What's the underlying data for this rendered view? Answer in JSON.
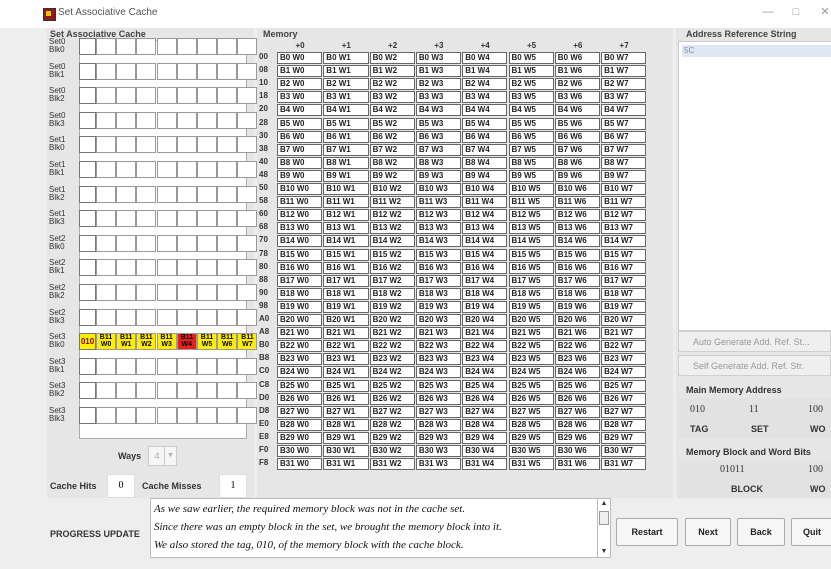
{
  "window": {
    "title": "Set Associative Cache",
    "minimize": "—",
    "maximize": "□",
    "close": "✕"
  },
  "cache": {
    "title": "Set Associative Cache",
    "rows": [
      {
        "set": "Set0",
        "blk": "Blk0",
        "tag": "",
        "cells": [
          "",
          "",
          "",
          "",
          "",
          "",
          "",
          ""
        ],
        "filled": false
      },
      {
        "set": "Set0",
        "blk": "Blk1",
        "tag": "",
        "cells": [
          "",
          "",
          "",
          "",
          "",
          "",
          "",
          ""
        ],
        "filled": false
      },
      {
        "set": "Set0",
        "blk": "Blk2",
        "tag": "",
        "cells": [
          "",
          "",
          "",
          "",
          "",
          "",
          "",
          ""
        ],
        "filled": false
      },
      {
        "set": "Set0",
        "blk": "Blk3",
        "tag": "",
        "cells": [
          "",
          "",
          "",
          "",
          "",
          "",
          "",
          ""
        ],
        "filled": false
      },
      {
        "set": "Set1",
        "blk": "Blk0",
        "tag": "",
        "cells": [
          "",
          "",
          "",
          "",
          "",
          "",
          "",
          ""
        ],
        "filled": false
      },
      {
        "set": "Set1",
        "blk": "Blk1",
        "tag": "",
        "cells": [
          "",
          "",
          "",
          "",
          "",
          "",
          "",
          ""
        ],
        "filled": false
      },
      {
        "set": "Set1",
        "blk": "Blk2",
        "tag": "",
        "cells": [
          "",
          "",
          "",
          "",
          "",
          "",
          "",
          ""
        ],
        "filled": false
      },
      {
        "set": "Set1",
        "blk": "Blk3",
        "tag": "",
        "cells": [
          "",
          "",
          "",
          "",
          "",
          "",
          "",
          ""
        ],
        "filled": false
      },
      {
        "set": "Set2",
        "blk": "Blk0",
        "tag": "",
        "cells": [
          "",
          "",
          "",
          "",
          "",
          "",
          "",
          ""
        ],
        "filled": false
      },
      {
        "set": "Set2",
        "blk": "Blk1",
        "tag": "",
        "cells": [
          "",
          "",
          "",
          "",
          "",
          "",
          "",
          ""
        ],
        "filled": false
      },
      {
        "set": "Set2",
        "blk": "Blk2",
        "tag": "",
        "cells": [
          "",
          "",
          "",
          "",
          "",
          "",
          "",
          ""
        ],
        "filled": false
      },
      {
        "set": "Set2",
        "blk": "Blk3",
        "tag": "",
        "cells": [
          "",
          "",
          "",
          "",
          "",
          "",
          "",
          ""
        ],
        "filled": false
      },
      {
        "set": "Set3",
        "blk": "Blk0",
        "tag": "010",
        "cells": [
          "B11 W0",
          "B11 W1",
          "B11 W2",
          "B11 W3",
          "B11 W4",
          "B11 W5",
          "B11 W6",
          "B11 W7"
        ],
        "filled": true
      },
      {
        "set": "Set3",
        "blk": "Blk1",
        "tag": "",
        "cells": [
          "",
          "",
          "",
          "",
          "",
          "",
          "",
          ""
        ],
        "filled": false
      },
      {
        "set": "Set3",
        "blk": "Blk2",
        "tag": "",
        "cells": [
          "",
          "",
          "",
          "",
          "",
          "",
          "",
          ""
        ],
        "filled": false
      },
      {
        "set": "Set3",
        "blk": "Blk3",
        "tag": "",
        "cells": [
          "",
          "",
          "",
          "",
          "",
          "",
          "",
          ""
        ],
        "filled": false
      }
    ],
    "ways_label": "Ways",
    "ways_value": "4",
    "hits_label": "Cache Hits",
    "hits_value": "0",
    "misses_label": "Cache Misses",
    "misses_value": "1",
    "colors": {
      "filled": "#ffee00",
      "current_word": "#e8201a",
      "tag_text": "#7a0000"
    }
  },
  "memory": {
    "title": "Memory",
    "offsets": [
      "+0",
      "+1",
      "+2",
      "+3",
      "+4",
      "+5",
      "+6",
      "+7"
    ],
    "addresses": [
      "00",
      "08",
      "10",
      "18",
      "20",
      "28",
      "30",
      "38",
      "40",
      "48",
      "50",
      "58",
      "60",
      "68",
      "70",
      "78",
      "80",
      "88",
      "90",
      "98",
      "A0",
      "A8",
      "B0",
      "B8",
      "C0",
      "C8",
      "D0",
      "D8",
      "E0",
      "E8",
      "F0",
      "F8"
    ],
    "rows": [
      [
        "B0 W0",
        "B0 W1",
        "B0 W2",
        "B0 W3",
        "B0 W4",
        "B0 W5",
        "B0 W6",
        "B0 W7"
      ],
      [
        "B1 W0",
        "B1 W1",
        "B1 W2",
        "B1 W3",
        "B1 W4",
        "B1 W5",
        "B1 W6",
        "B1 W7"
      ],
      [
        "B2 W0",
        "B2 W1",
        "B2 W2",
        "B2 W3",
        "B2 W4",
        "B2 W5",
        "B2 W6",
        "B2 W7"
      ],
      [
        "B3 W0",
        "B3 W1",
        "B3 W2",
        "B3 W3",
        "B3 W4",
        "B3 W5",
        "B3 W6",
        "B3 W7"
      ],
      [
        "B4 W0",
        "B4 W1",
        "B4 W2",
        "B4 W3",
        "B4 W4",
        "B4 W5",
        "B4 W6",
        "B4 W7"
      ],
      [
        "B5 W0",
        "B5 W1",
        "B5 W2",
        "B5 W3",
        "B5 W4",
        "B5 W5",
        "B5 W6",
        "B5 W7"
      ],
      [
        "B6 W0",
        "B6 W1",
        "B6 W2",
        "B6 W3",
        "B6 W4",
        "B6 W5",
        "B6 W6",
        "B6 W7"
      ],
      [
        "B7 W0",
        "B7 W1",
        "B7 W2",
        "B7 W3",
        "B7 W4",
        "B7 W5",
        "B7 W6",
        "B7 W7"
      ],
      [
        "B8 W0",
        "B8 W1",
        "B8 W2",
        "B8 W3",
        "B8 W4",
        "B8 W5",
        "B8 W6",
        "B8 W7"
      ],
      [
        "B9 W0",
        "B9 W1",
        "B9 W2",
        "B9 W3",
        "B9 W4",
        "B9 W5",
        "B9 W6",
        "B9 W7"
      ],
      [
        "B10 W0",
        "B10 W1",
        "B10 W2",
        "B10 W3",
        "B10 W4",
        "B10 W5",
        "B10 W6",
        "B10 W7"
      ],
      [
        "B11 W0",
        "B11 W1",
        "B11 W2",
        "B11 W3",
        "B11 W4",
        "B11 W5",
        "B11 W6",
        "B11 W7"
      ],
      [
        "B12 W0",
        "B12 W1",
        "B12 W2",
        "B12 W3",
        "B12 W4",
        "B12 W5",
        "B12 W6",
        "B12 W7"
      ],
      [
        "B13 W0",
        "B13 W1",
        "B13 W2",
        "B13 W3",
        "B13 W4",
        "B13 W5",
        "B13 W6",
        "B13 W7"
      ],
      [
        "B14 W0",
        "B14 W1",
        "B14 W2",
        "B14 W3",
        "B14 W4",
        "B14 W5",
        "B14 W6",
        "B14 W7"
      ],
      [
        "B15 W0",
        "B15 W1",
        "B15 W2",
        "B15 W3",
        "B15 W4",
        "B15 W5",
        "B15 W6",
        "B15 W7"
      ],
      [
        "B16 W0",
        "B16 W1",
        "B16 W2",
        "B16 W3",
        "B16 W4",
        "B16 W5",
        "B16 W6",
        "B16 W7"
      ],
      [
        "B17 W0",
        "B17 W1",
        "B17 W2",
        "B17 W3",
        "B17 W4",
        "B17 W5",
        "B17 W6",
        "B17 W7"
      ],
      [
        "B18 W0",
        "B18 W1",
        "B18 W2",
        "B18 W3",
        "B18 W4",
        "B18 W5",
        "B18 W6",
        "B18 W7"
      ],
      [
        "B19 W0",
        "B19 W1",
        "B19 W2",
        "B19 W3",
        "B19 W4",
        "B19 W5",
        "B19 W6",
        "B19 W7"
      ],
      [
        "B20 W0",
        "B20 W1",
        "B20 W2",
        "B20 W3",
        "B20 W4",
        "B20 W5",
        "B20 W6",
        "B20 W7"
      ],
      [
        "B21 W0",
        "B21 W1",
        "B21 W2",
        "B21 W3",
        "B21 W4",
        "B21 W5",
        "B21 W6",
        "B21 W7"
      ],
      [
        "B22 W0",
        "B22 W1",
        "B22 W2",
        "B22 W3",
        "B22 W4",
        "B22 W5",
        "B22 W6",
        "B22 W7"
      ],
      [
        "B23 W0",
        "B23 W1",
        "B23 W2",
        "B23 W3",
        "B23 W4",
        "B23 W5",
        "B23 W6",
        "B23 W7"
      ],
      [
        "B24 W0",
        "B24 W1",
        "B24 W2",
        "B24 W3",
        "B24 W4",
        "B24 W5",
        "B24 W6",
        "B24 W7"
      ],
      [
        "B25 W0",
        "B25 W1",
        "B25 W2",
        "B25 W3",
        "B25 W4",
        "B25 W5",
        "B25 W6",
        "B25 W7"
      ],
      [
        "B26 W0",
        "B26 W1",
        "B26 W2",
        "B26 W3",
        "B26 W4",
        "B26 W5",
        "B26 W6",
        "B26 W7"
      ],
      [
        "B27 W0",
        "B27 W1",
        "B27 W2",
        "B27 W3",
        "B27 W4",
        "B27 W5",
        "B27 W6",
        "B27 W7"
      ],
      [
        "B28 W0",
        "B28 W1",
        "B28 W2",
        "B28 W3",
        "B28 W4",
        "B28 W5",
        "B28 W6",
        "B28 W7"
      ],
      [
        "B29 W0",
        "B29 W1",
        "B29 W2",
        "B29 W3",
        "B29 W4",
        "B29 W5",
        "B29 W6",
        "B29 W7"
      ],
      [
        "B30 W0",
        "B30 W1",
        "B30 W2",
        "B30 W3",
        "B30 W4",
        "B30 W5",
        "B30 W6",
        "B30 W7"
      ],
      [
        "B31 W0",
        "B31 W1",
        "B31 W2",
        "B31 W3",
        "B31 W4",
        "B31 W5",
        "B31 W6",
        "B31 W7"
      ]
    ]
  },
  "reference": {
    "title": "Address Reference String",
    "items": [
      "5C"
    ],
    "auto_button": "Auto Generate Add. Ref. St...",
    "self_button": "Self Generate Add. Ref. Str."
  },
  "main_memory_address": {
    "title": "Main Memory Address",
    "tag": "010",
    "set": "11",
    "word": "100",
    "tag_label": "TAG",
    "set_label": "SET",
    "word_label": "WO"
  },
  "block_word_bits": {
    "title": "Memory Block and Word Bits",
    "block": "01011",
    "word": "100",
    "block_label": "BLOCK",
    "word_label": "WO"
  },
  "progress": {
    "label": "PROGRESS UPDATE",
    "lines": [
      "As we saw earlier, the required memory block was not in the cache set.",
      "Since there was an empty block in the set, we brought the memory block into it.",
      "We also stored the tag, 010, of the memory block with the cache block."
    ]
  },
  "buttons": {
    "restart": "Restart",
    "next": "Next",
    "back": "Back",
    "quit": "Quit"
  }
}
